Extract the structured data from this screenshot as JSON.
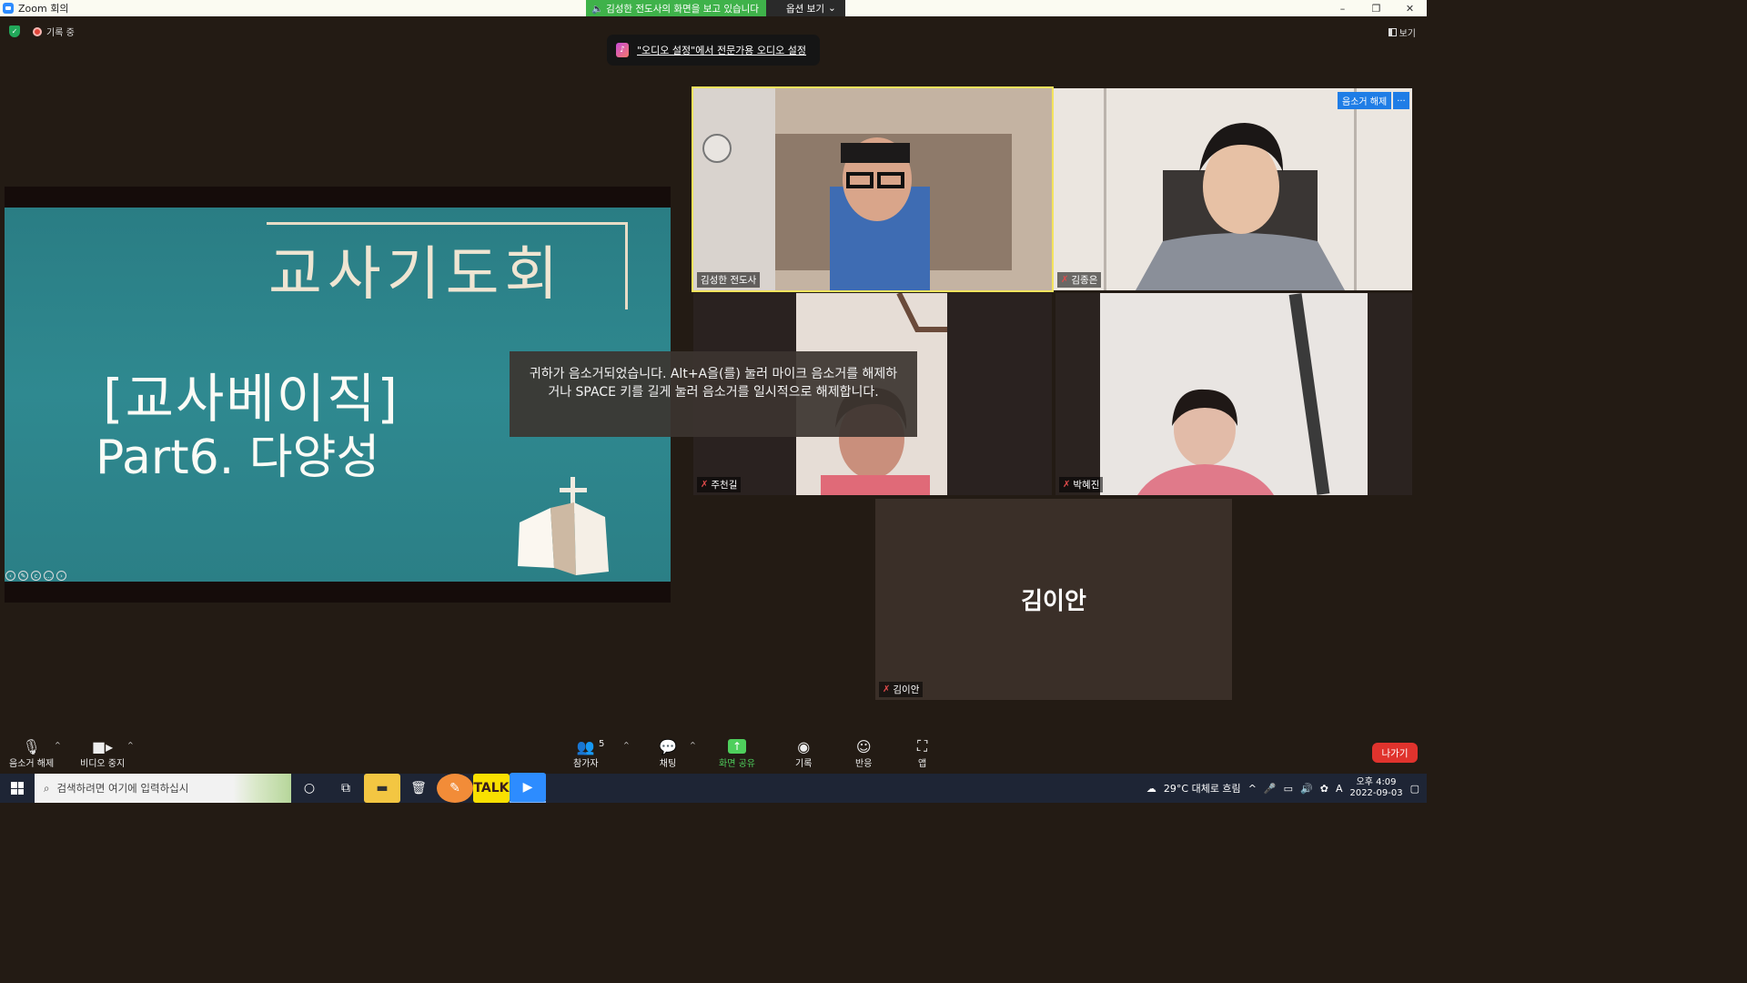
{
  "window": {
    "title": "Zoom 회의",
    "share_status": "김성한 전도사의 화면을 보고 있습니다",
    "view_options": "옵션 보기",
    "controls": [
      "–",
      "❐",
      "✕"
    ]
  },
  "status": {
    "recording": "기록 중",
    "view": "보기"
  },
  "notification": {
    "text": "\"오디오 설정\"에서 전문가용 오디오 설정"
  },
  "slide": {
    "line1": "교사기도회",
    "line2": "[교사베이직]",
    "line3": "Part6. 다양성"
  },
  "participants": [
    {
      "name": "김성한 전도사",
      "muted": false,
      "speaking": true
    },
    {
      "name": "김종은",
      "muted": true
    },
    {
      "name": "주천길",
      "muted": true
    },
    {
      "name": "박혜진",
      "muted": true
    },
    {
      "name": "김이안",
      "muted": true,
      "video_off": true
    }
  ],
  "unmute_request": {
    "label": "음소거 해제",
    "more": "..."
  },
  "toast": {
    "text": "귀하가 음소거되었습니다. Alt+A을(를) 눌러 마이크 음소거를 해제하거나 SPACE 키를 길게 눌러 음소거를 일시적으로 해제합니다."
  },
  "toolbar": {
    "unmute": "음소거 해제",
    "video": "비디오 중지",
    "participants": "참가자",
    "participant_count": "5",
    "chat": "채팅",
    "share": "화면 공유",
    "record": "기록",
    "reactions": "반응",
    "apps": "앱",
    "leave": "나가기"
  },
  "taskbar": {
    "search_placeholder": "검색하려면 여기에 입력하십시",
    "weather": "29°C 대체로 흐림",
    "ime": "A",
    "time": "오후 4:09",
    "date": "2022-09-03"
  },
  "colors": {
    "accent": "#2d8cff",
    "share_green": "#3fb24a",
    "leave_red": "#e0332d",
    "speaker_border": "#f3e35d"
  }
}
